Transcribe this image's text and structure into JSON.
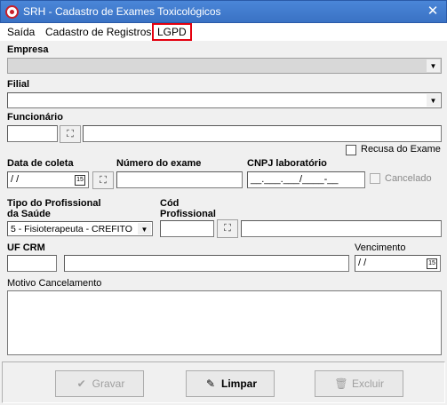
{
  "window": {
    "title": "SRH - Cadastro de Exames Toxicológicos",
    "close_glyph": "✕",
    "accent": "#e4000f"
  },
  "menu": {
    "items": [
      "Saída",
      "Cadastro de Registros",
      "LGPD"
    ],
    "highlighted": "LGPD"
  },
  "form": {
    "empresa_label": "Empresa",
    "empresa_value": "",
    "filial_label": "Filial",
    "filial_value": "",
    "funcionario_label": "Funcionário",
    "funcionario_code": "",
    "funcionario_name": "",
    "recusa_label": "Recusa do Exame",
    "recusa_checked": false,
    "data_coleta_label": "Data de coleta",
    "data_coleta_value": " / /",
    "numero_exame_label": "Número do exame",
    "numero_exame_value": "",
    "cnpj_label": "CNPJ laboratório",
    "cnpj_value": "__.___.___/____-__",
    "cancelado_label": "Cancelado",
    "cancelado_checked": false,
    "tipo_prof_label_1": "Tipo do Profissional",
    "tipo_prof_label_2": "da Saúde",
    "tipo_prof_value": "5 - Fisioterapeuta - CREFITO",
    "cod_prof_label_1": "Cód",
    "cod_prof_label_2": "Profissional",
    "cod_prof_value": "",
    "prof_name_value": "",
    "uf_crm_label": "UF CRM",
    "uf_value": "",
    "crm_value": "",
    "vencimento_label": "Vencimento",
    "vencimento_value": " / /",
    "motivo_label": "Motivo Cancelamento",
    "motivo_value": ""
  },
  "icons": {
    "calendar_glyph": "15",
    "binoculars_glyph": "⛶",
    "dropdown_glyph": "▼"
  },
  "buttons": {
    "gravar": {
      "label": "Gravar",
      "icon": "✔",
      "enabled": false
    },
    "limpar": {
      "label": "Limpar",
      "icon": "✎",
      "enabled": true
    },
    "excluir": {
      "label": "Excluir",
      "icon": "🗑",
      "enabled": false
    }
  }
}
